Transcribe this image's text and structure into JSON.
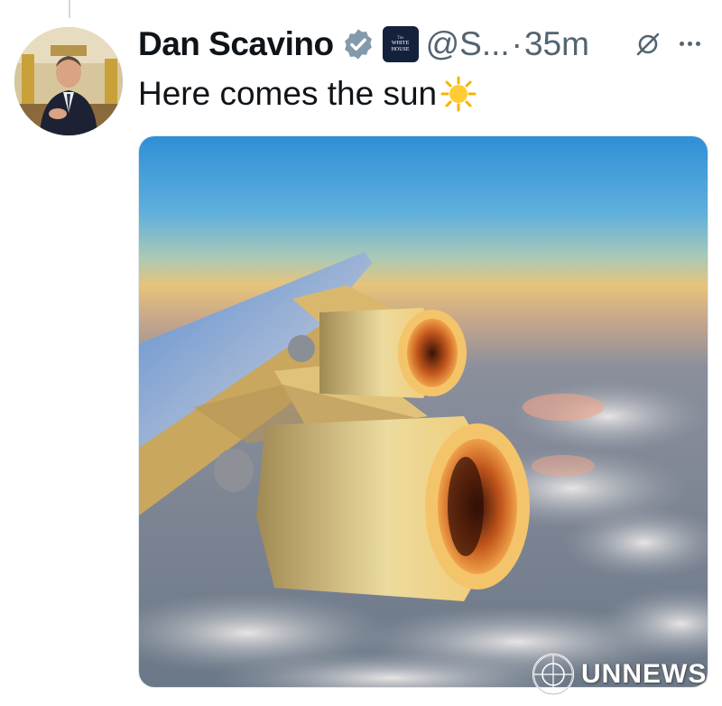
{
  "tweet": {
    "author_name": "Dan Scavino",
    "verified_icon": "verified-badge-icon",
    "org_badge": {
      "line1": "WHITE",
      "line2": "HOUSE",
      "top": "The"
    },
    "handle": "@S...",
    "separator": "·",
    "time": "35m",
    "text": "Here comes the sun",
    "emoji": "sun-emoji",
    "media_alt": "Airplane wing and jet engines above clouds at sunrise"
  },
  "actions": {
    "grok_icon": "grok-icon",
    "more_icon": "more-icon"
  },
  "watermark": {
    "text": "UNNEWS"
  },
  "colors": {
    "text_primary": "#0f1419",
    "text_secondary": "#536471",
    "verified": "#1d9bf0",
    "org_badge_bg": "#14213d"
  }
}
